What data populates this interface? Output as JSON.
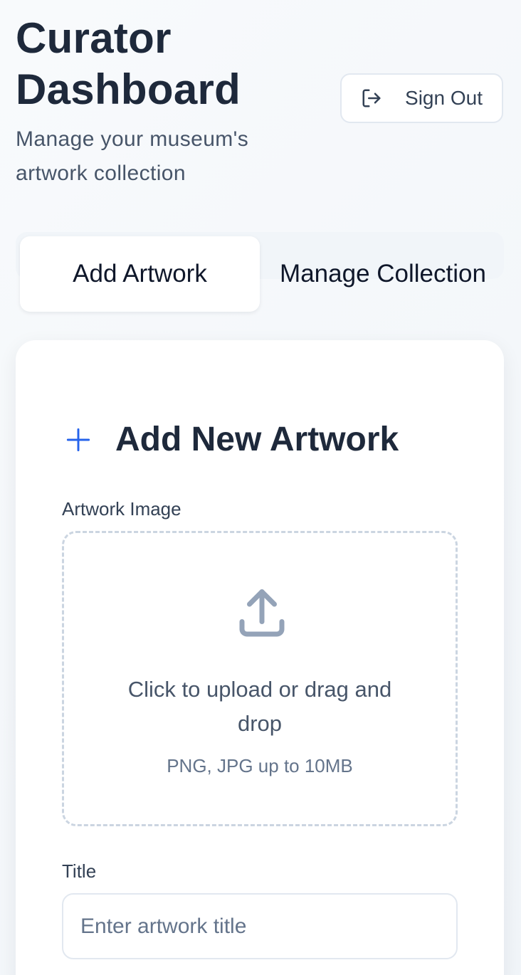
{
  "header": {
    "title_line1": "Curator",
    "title_line2": "Dashboard",
    "subtitle_line1": "Manage your museum's",
    "subtitle_line2": "artwork collection",
    "sign_out_label": "Sign Out"
  },
  "tabs": [
    {
      "label": "Add Artwork",
      "active": true
    },
    {
      "label": "Manage Collection",
      "active": false
    }
  ],
  "form": {
    "heading": "Add New Artwork",
    "image_label": "Artwork Image",
    "upload_text_line1": "Click to upload or drag and",
    "upload_text_line2": "drop",
    "upload_hint": "PNG, JPG up to 10MB",
    "title_label": "Title",
    "title_placeholder": "Enter artwork title"
  },
  "icons": {
    "sign_out": "sign-out-icon",
    "add": "plus-icon",
    "upload": "upload-icon"
  },
  "colors": {
    "accent": "#2563eb",
    "text_primary": "#1e293b",
    "text_muted": "#64748b",
    "border": "#e2e8f0",
    "dash": "#cbd5e1"
  }
}
